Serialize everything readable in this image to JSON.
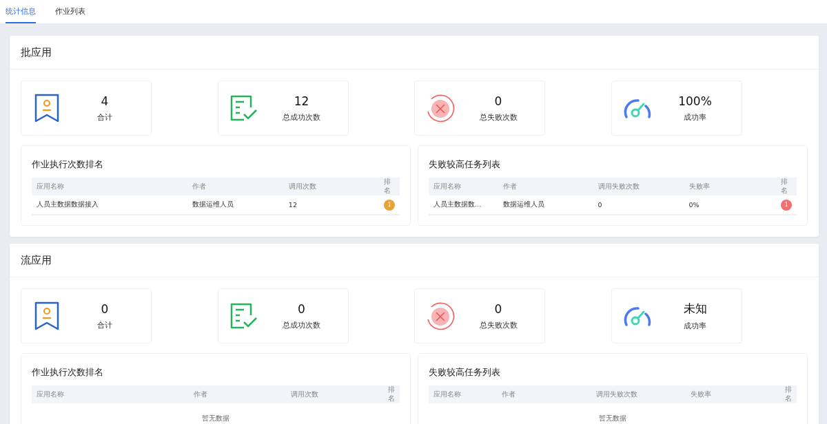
{
  "tabs": [
    {
      "label": "统计信息",
      "selected": true
    },
    {
      "label": "作业列表",
      "selected": false
    }
  ],
  "sections": [
    {
      "title": "批应用",
      "stats": [
        {
          "kind": "total",
          "value": "4",
          "label": "合计"
        },
        {
          "kind": "success",
          "value": "12",
          "label": "总成功次数"
        },
        {
          "kind": "failure",
          "value": "0",
          "label": "总失败次数"
        },
        {
          "kind": "rate",
          "value": "100%",
          "label": "成功率"
        }
      ],
      "tables": [
        {
          "title": "作业执行次数排名",
          "columns": [
            "应用名称",
            "作者",
            "调用次数",
            "排名"
          ],
          "rows": [
            {
              "cells": [
                "人员主数据数据接入",
                "数据运维人员",
                "12"
              ],
              "rank": "1",
              "color": "#e8a23a"
            }
          ]
        },
        {
          "title": "失败较高任务列表",
          "columns": [
            "应用名称",
            "作者",
            "调用失败次数",
            "失败率",
            "排名"
          ],
          "rows": [
            {
              "cells": [
                "人员主数据数…",
                "数据运维人员",
                "0",
                "0%"
              ],
              "rank": "1",
              "color": "#f07070"
            }
          ]
        }
      ]
    },
    {
      "title": "流应用",
      "stats": [
        {
          "kind": "total",
          "value": "0",
          "label": "合计"
        },
        {
          "kind": "success",
          "value": "0",
          "label": "总成功次数"
        },
        {
          "kind": "failure",
          "value": "0",
          "label": "总失败次数"
        },
        {
          "kind": "rate",
          "value": "未知",
          "label": "成功率"
        }
      ],
      "tables": [
        {
          "title": "作业执行次数排名",
          "columns": [
            "应用名称",
            "作者",
            "调用次数",
            "排名"
          ],
          "empty_text": "暂无数据"
        },
        {
          "title": "失败较高任务列表",
          "columns": [
            "应用名称",
            "作者",
            "调用失败次数",
            "失败率",
            "排名"
          ],
          "empty_text": "暂无数据"
        }
      ]
    }
  ]
}
